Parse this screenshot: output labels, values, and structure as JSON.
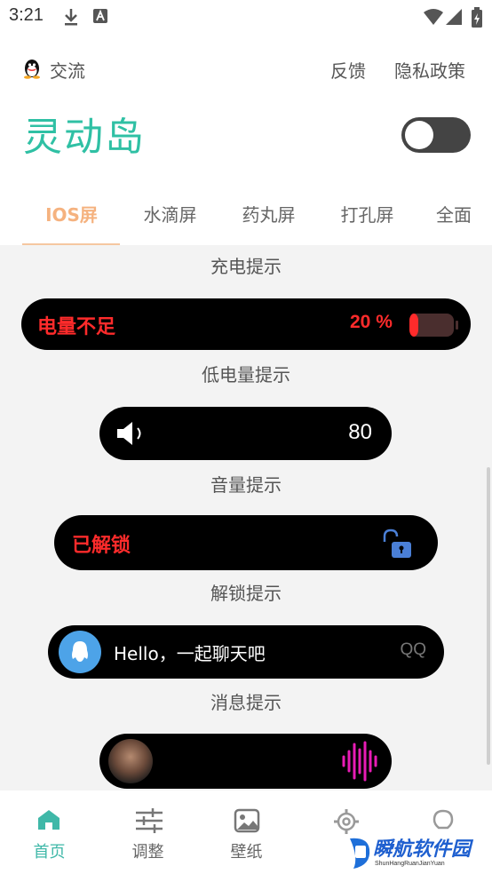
{
  "status_bar": {
    "time": "3:21"
  },
  "header": {
    "chat_label": "交流",
    "feedback_label": "反馈",
    "privacy_label": "隐私政策",
    "title": "灵动岛",
    "toggle_on": false
  },
  "tabs": [
    {
      "label": "IOS屏",
      "active": true
    },
    {
      "label": "水滴屏",
      "active": false
    },
    {
      "label": "药丸屏",
      "active": false
    },
    {
      "label": "打孔屏",
      "active": false
    },
    {
      "label": "全面",
      "active": false
    }
  ],
  "content": {
    "charge_caption": "充电提示",
    "battery": {
      "text": "电量不足",
      "percent": "20 %",
      "level_fraction": 0.2,
      "caption": "低电量提示"
    },
    "volume": {
      "value": "80",
      "caption": "音量提示"
    },
    "unlock": {
      "text": "已解锁",
      "caption": "解锁提示"
    },
    "message": {
      "text": "Hello，一起聊天吧",
      "app": "QQ",
      "caption": "消息提示"
    }
  },
  "colors": {
    "accent": "#2fc0a4",
    "tab_active": "#f5b27f",
    "alert_red": "#ff2b2b",
    "lock_blue": "#4a7fd6",
    "wave_pink": "#e81cb5"
  },
  "bottom_nav": [
    {
      "label": "首页",
      "icon": "home-icon",
      "active": true
    },
    {
      "label": "调整",
      "icon": "sliders-icon",
      "active": false
    },
    {
      "label": "壁纸",
      "icon": "image-icon",
      "active": false
    },
    {
      "label": "",
      "icon": "gear-icon",
      "active": false
    },
    {
      "label": "",
      "icon": "bulb-icon",
      "active": false
    }
  ],
  "watermark": {
    "main": "瞬航软件园",
    "sub": "ShunHangRuanJianYuan"
  }
}
